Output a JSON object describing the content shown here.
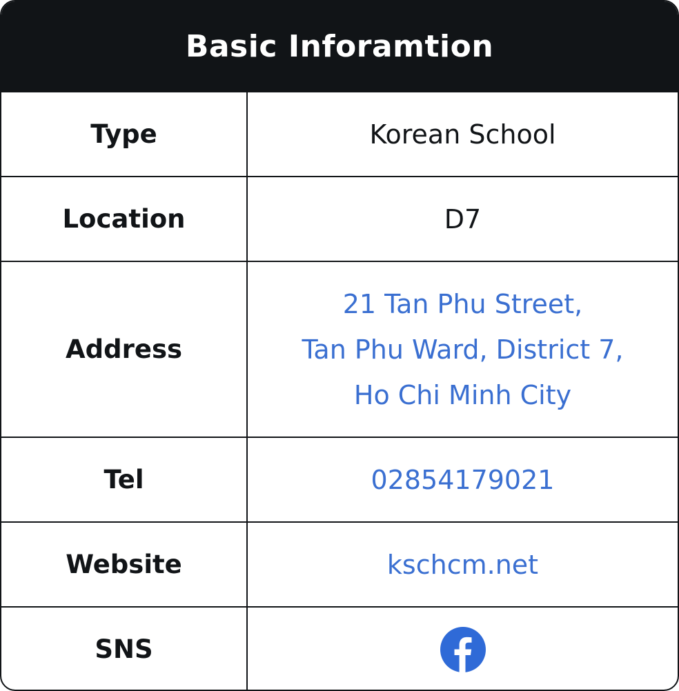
{
  "header": {
    "title": "Basic Inforamtion"
  },
  "rows": {
    "type": {
      "label": "Type",
      "value": "Korean School"
    },
    "location": {
      "label": "Location",
      "value": "D7"
    },
    "address": {
      "label": "Address",
      "lines": [
        "21 Tan Phu Street,",
        "Tan Phu Ward, District 7,",
        "Ho Chi Minh City"
      ]
    },
    "tel": {
      "label": "Tel",
      "value": "02854179021"
    },
    "website": {
      "label": "Website",
      "value": "kschcm.net"
    },
    "sns": {
      "label": "SNS",
      "icon": "facebook-icon"
    }
  },
  "colors": {
    "header_bg": "#111417",
    "border": "#111417",
    "link": "#3a6fd1",
    "facebook": "#2f6ad7"
  }
}
